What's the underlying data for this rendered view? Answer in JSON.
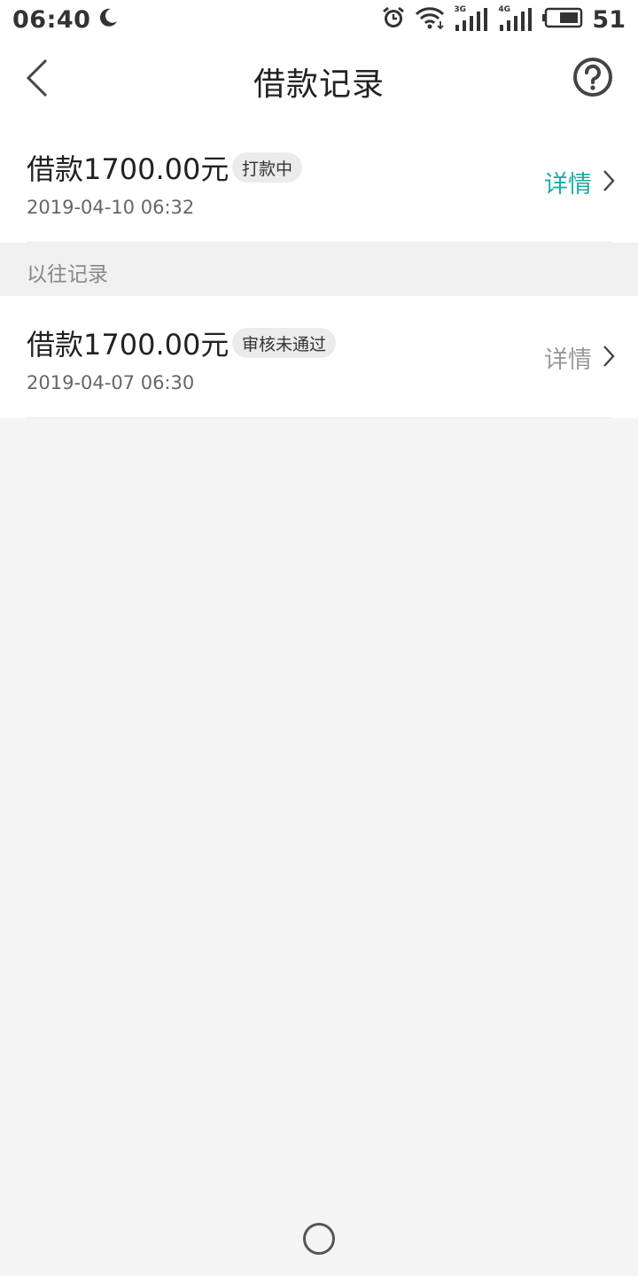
{
  "status_bar": {
    "time": "06:40",
    "battery_percent": "51",
    "signal_1_label": "3G",
    "signal_2_label": "4G"
  },
  "nav": {
    "title": "借款记录"
  },
  "colors": {
    "detail_active": "#1aada4",
    "detail_inactive": "#999999"
  },
  "current_record": {
    "amount": "借款1700.00元",
    "badge": "打款中",
    "date": "2019-04-10 06:32",
    "detail_label": "详情"
  },
  "section": {
    "title": "以往记录"
  },
  "past_record": {
    "amount": "借款1700.00元",
    "badge": "审核未通过",
    "date": "2019-04-07 06:30",
    "detail_label": "详情"
  }
}
